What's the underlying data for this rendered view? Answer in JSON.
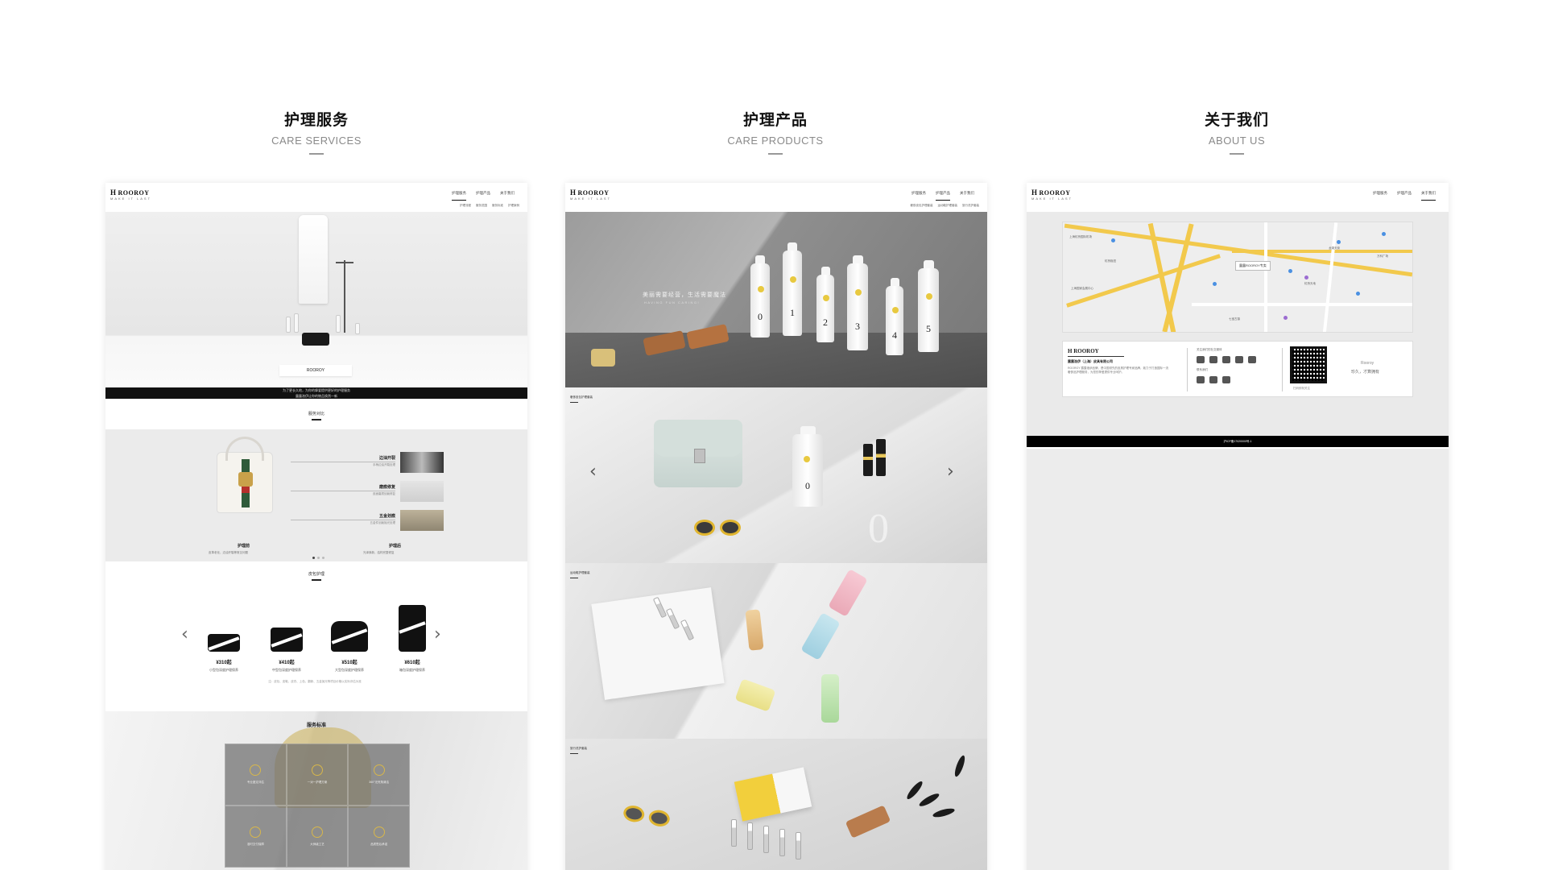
{
  "columns": [
    {
      "title_cn": "护理服务",
      "title_en": "CARE SERVICES"
    },
    {
      "title_cn": "护理产品",
      "title_en": "CARE PRODUCTS"
    },
    {
      "title_cn": "关于我们",
      "title_en": "ABOUT US"
    }
  ],
  "site": {
    "logo": "ROOROY",
    "logo_mark": "H",
    "tagline": "MAKE IT LAST",
    "nav": [
      "护理服务",
      "护理产品",
      "关于我们"
    ],
    "subnav": [
      "护理流程",
      "服务范围",
      "服务标准",
      "护理案例"
    ],
    "product_subnav": [
      "奢侈皮包护理套装",
      "运动鞋护理套装",
      "旅行洗护套装"
    ]
  },
  "panel1": {
    "hero_caption_line1": "为了更长久地，为你的挚爱提供更好的护理服务",
    "hero_caption_line2": "露露洛伊让你的物品焕然一新",
    "compare_title": "服务对比",
    "details": [
      {
        "title": "边油开裂",
        "sub": "手柄边油开裂处理"
      },
      {
        "title": "磨痕修复",
        "sub": "皮面磨损划痕修复"
      },
      {
        "title": "五金划痕",
        "sub": "五金件划痕抛光处理"
      }
    ],
    "before_label": "护理前",
    "before_sub": "皮革老化，边油开裂等常见问题",
    "after_label": "护理后",
    "after_sub": "光泽焕新，结构完整修复",
    "prices_title": "皮包护理",
    "prices": [
      {
        "price": "¥310起",
        "desc": "小型包深度护理保养"
      },
      {
        "price": "¥410起",
        "desc": "中型包深度护理保养"
      },
      {
        "price": "¥510起",
        "desc": "大型包深度护理保养"
      },
      {
        "price": "¥610起",
        "desc": "箱包深度护理保养"
      }
    ],
    "prices_note": "注：皮包、皮鞋、皮衣、上色、翻新、五金抛光等项目价格以实际评估为准",
    "std_title": "服务标准",
    "std_items": [
      "专业鉴定评估",
      "一对一护理方案",
      "360°无死角清洁",
      "准时交付保障",
      "大师级工艺",
      "品质售后承诺"
    ]
  },
  "panel2": {
    "slogan_cn": "美丽需要经营，生活需要魔法",
    "slogan_en": "HAVING FUN CARING!",
    "bottle_numbers": [
      "0",
      "1",
      "2",
      "3",
      "4",
      "5"
    ],
    "section_labels": [
      "奢侈皮包护理套装",
      "运动鞋护理套装",
      "旅行洗护套装"
    ],
    "big_number": "0"
  },
  "panel3": {
    "map_callout": "露露ROOROY专卖",
    "map_labels": [
      "上海虹桥国际机场",
      "虹桥枢纽",
      "上海国家会展中心",
      "虹桥天地",
      "龙湖天街",
      "万科广场",
      "七宝古镇"
    ],
    "company_logo": "ROOROY",
    "company_name": "露露洛伊（上海）皮具有限公司",
    "company_desc": "ROOROY 露露洛伊品牌，是中国领先的皮具护理专家品牌，致力于打造国际一流奢侈品护理服务，为您的挚爱提供专业呵护。",
    "social_heading": "关注我们的社交媒体",
    "contact_heading": "联系我们",
    "qr_caption": "扫码即刻关注",
    "slogan_en": "Rooroy",
    "slogan_cn": "珍久，才算拥有",
    "footer": "沪ICP备17020000号-1"
  }
}
